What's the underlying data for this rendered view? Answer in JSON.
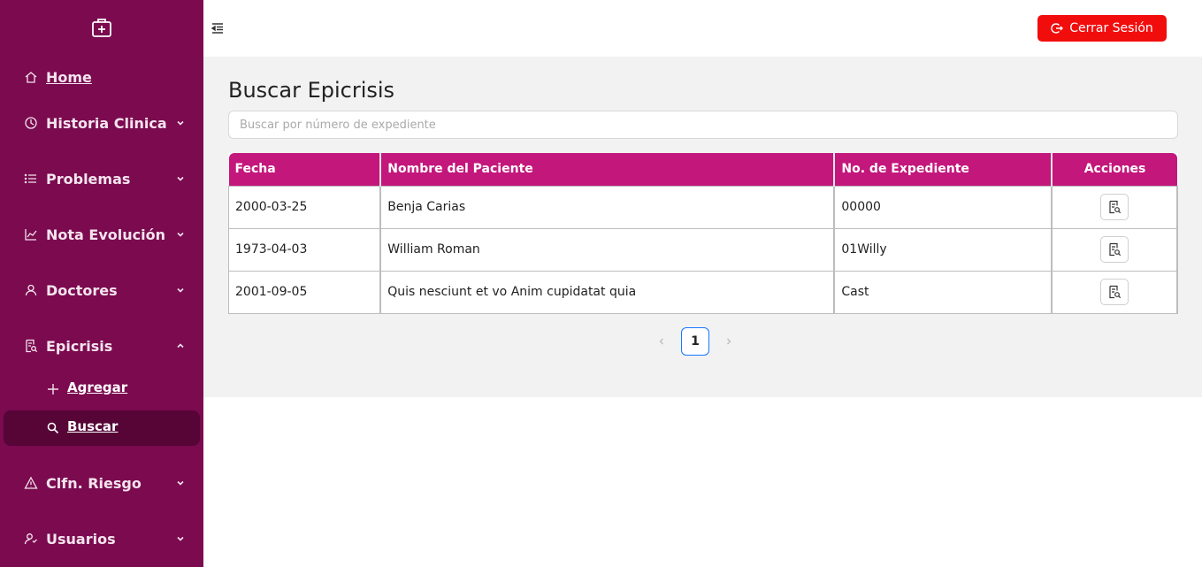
{
  "sidebar": {
    "logo_icon": "medical-case-icon",
    "items": [
      {
        "label": "Home",
        "icon": "home-icon"
      },
      {
        "label": "Historia Clinica",
        "icon": "history-icon"
      },
      {
        "label": "Problemas",
        "icon": "list-icon"
      },
      {
        "label": "Nota Evolución",
        "icon": "line-chart-icon"
      },
      {
        "label": "Doctores",
        "icon": "user-icon"
      },
      {
        "label": "Epicrisis",
        "icon": "file-search-icon"
      },
      {
        "label": "Clfn. Riesgo",
        "icon": "warning-icon"
      },
      {
        "label": "Usuarios",
        "icon": "users-icon"
      }
    ],
    "sub_items": [
      {
        "label": "Agregar",
        "icon": "plus-icon"
      },
      {
        "label": "Buscar",
        "icon": "search-icon",
        "active": true
      }
    ]
  },
  "topbar": {
    "logout_label": "Cerrar Sesión",
    "logout_color": "#f20d0d"
  },
  "main": {
    "title": "Buscar Epicrisis",
    "search_placeholder": "Buscar por número de expediente",
    "table": {
      "headers": [
        "Fecha",
        "Nombre del Paciente",
        "No. de Expediente",
        "Acciones"
      ],
      "rows": [
        {
          "fecha": "2000-03-25",
          "nombre": "Benja Carias",
          "expediente": "00000"
        },
        {
          "fecha": "1973-04-03",
          "nombre": "William Roman",
          "expediente": "01Willy"
        },
        {
          "fecha": "2001-09-05",
          "nombre": "Quis nesciunt et vo Anim cupidatat quia",
          "expediente": "Cast"
        }
      ]
    },
    "pagination": {
      "current_page": "1"
    }
  },
  "colors": {
    "sidebar_bg": "#7b0a4f",
    "active_bg": "#560536",
    "table_header": "#c3177c",
    "accent": "#1677ff"
  }
}
